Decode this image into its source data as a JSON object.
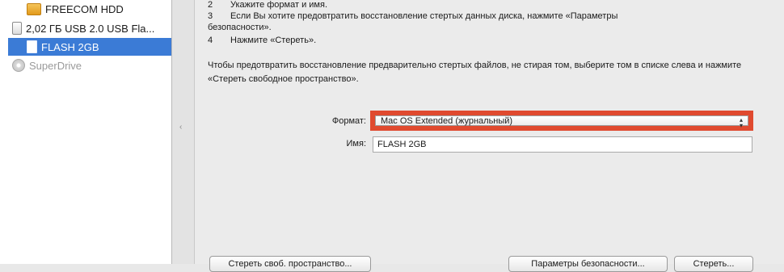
{
  "sidebar": {
    "items": [
      {
        "label": "FREECOM HDD",
        "icon": "hdd-icon"
      },
      {
        "label": "2,02 ГБ USB 2.0 USB Fla...",
        "icon": "usb-drive-icon"
      },
      {
        "label": "FLASH 2GB",
        "icon": "volume-icon",
        "selected": true
      },
      {
        "label": "SuperDrive",
        "icon": "disc-icon",
        "disabled": true
      }
    ]
  },
  "instructions": [
    {
      "num": "2",
      "text": "Укажите формат и имя."
    },
    {
      "num": "3",
      "text": "Если Вы хотите предовтратить восстановление стертых данных диска, нажмите «Параметры"
    },
    {
      "num": "",
      "text": "безопасности»."
    },
    {
      "num": "4",
      "text": "Нажмите «Стереть»."
    }
  ],
  "paragraph": "Чтобы предотвратить восстановление предварительно стертых файлов, не стирая том, выберите том в списке слева и нажмите «Стереть свободное пространство».",
  "form": {
    "format_label": "Формат:",
    "format_value": "Mac OS Extended (журнальный)",
    "name_label": "Имя:",
    "name_value": "FLASH 2GB",
    "highlight_color": "#e04a2f"
  },
  "buttons": {
    "erase_free_space": "Стереть своб. пространство...",
    "security_options": "Параметры безопасности...",
    "erase": "Стереть..."
  }
}
